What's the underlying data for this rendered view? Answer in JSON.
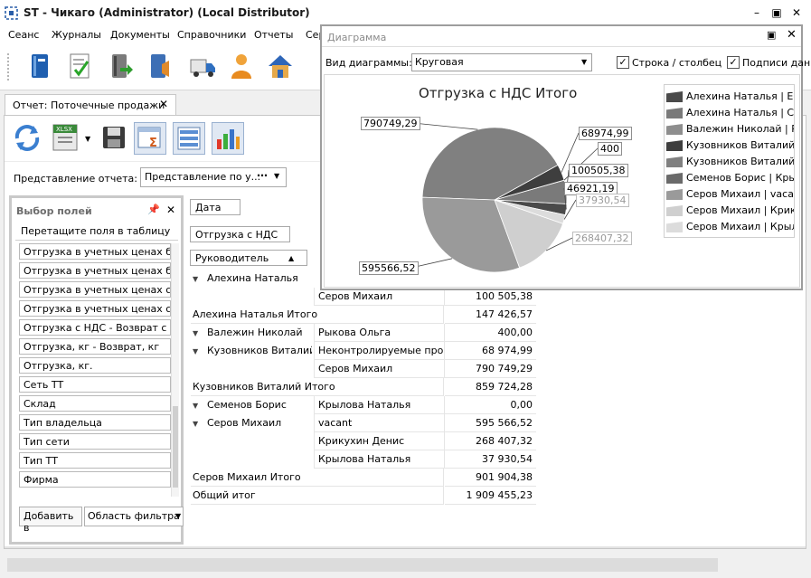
{
  "window": {
    "title": "ST - Чикаго (Administrator) (Local Distributor)"
  },
  "menu": [
    "Сеанс",
    "Журналы",
    "Документы",
    "Справочники",
    "Отчеты",
    "Сер"
  ],
  "toolbar_icons": [
    "book-icon",
    "checklist-icon",
    "document-export-icon",
    "document-import-icon",
    "delivery-truck-icon",
    "user-icon",
    "house-icon"
  ],
  "tab": {
    "label": "Отчет: Поточечные продажи"
  },
  "subtoolbar_icons": [
    "refresh-icon",
    "export-xlsx-icon",
    "save-icon",
    "pivot-summary-icon",
    "field-list-icon",
    "chart-icon"
  ],
  "report_view": {
    "label": "Представление отчета:",
    "value": "Представление по у..."
  },
  "field_panel": {
    "title": "Выбор полей",
    "hint": "Перетащите поля в таблицу",
    "items": [
      "Отгрузка в учетных ценах б...",
      "Отгрузка в учетных ценах б...",
      "Отгрузка в учетных ценах с...",
      "Отгрузка в учетных ценах с...",
      "Отгрузка с НДС - Возврат с ...",
      "Отгрузка, кг - Возврат, кг",
      "Отгрузка, кг.",
      "Сеть ТТ",
      "Склад",
      "Тип владельца",
      "Тип сети",
      "Тип ТТ",
      "Фирма"
    ],
    "add_button": "Добавить в",
    "area_value": "Область фильтра"
  },
  "pivot": {
    "column_field": "Дата",
    "data_field": "Отгрузка с НДС",
    "row_field": "Руководитель",
    "rows": [
      {
        "level1": "Алехина Наталья",
        "level2": "",
        "value": ""
      },
      {
        "level1": "",
        "level2": "Серов Михаил",
        "value": "100 505,38"
      },
      {
        "total": "Алехина Наталья Итого",
        "value": "147 426,57"
      },
      {
        "level1": "Валежин Николай",
        "level2": "Рыкова Ольга",
        "value": "400,00"
      },
      {
        "level1": "Кузовников Виталий",
        "level2": "Неконтролируемые про...",
        "value": "68 974,99"
      },
      {
        "level1": "",
        "level2": "Серов Михаил",
        "value": "790 749,29"
      },
      {
        "total": "Кузовников Виталий Итого",
        "value": "859 724,28"
      },
      {
        "level1": "Семенов Борис",
        "level2": "Крылова Наталья",
        "value": "0,00"
      },
      {
        "level1": "Серов Михаил",
        "level2": "vacant",
        "value": "595 566,52"
      },
      {
        "level1": "",
        "level2": "Крикухин Денис",
        "value": "268 407,32"
      },
      {
        "level1": "",
        "level2": "Крылова Наталья",
        "value": "37 930,54"
      },
      {
        "total": "Серов Михаил Итого",
        "value": "901 904,38"
      },
      {
        "total": "Общий итог",
        "value": "1 909 455,23"
      }
    ]
  },
  "diagram": {
    "title": "Диаграмма",
    "type_label": "Вид диаграммы:",
    "type_value": "Круговая",
    "check_row_col": "Строка / столбец",
    "check_labels": "Подписи дан"
  },
  "chart_data": {
    "type": "pie",
    "title": "Отгрузка с НДС Итого",
    "labels": [
      "Алехина Наталья | Ерм",
      "Алехина Наталья | Сер",
      "Валежин Николай | Рык",
      "Кузовников Виталий | Н",
      "Кузовников Виталий | С",
      "Семенов Борис | Крылс",
      "Серов Михаил | vacant",
      "Серов Михаил | Крикух",
      "Серов Михаил | Крылов"
    ],
    "values": [
      46921.19,
      100505.38,
      400,
      68974.99,
      790749.29,
      0,
      595566.52,
      268407.32,
      37930.54
    ],
    "data_labels": [
      "46921,19",
      "100505,38",
      "400",
      "68974,99",
      "790749,29",
      "",
      "595566,52",
      "268407,32",
      "37930,54"
    ],
    "colors": [
      "#4a4a4a",
      "#7a7a7a",
      "#8e8e8e",
      "#3e3e3e",
      "#808080",
      "#6a6a6a",
      "#9a9a9a",
      "#cfcfcf",
      "#dcdcdc"
    ],
    "legend": "right"
  }
}
